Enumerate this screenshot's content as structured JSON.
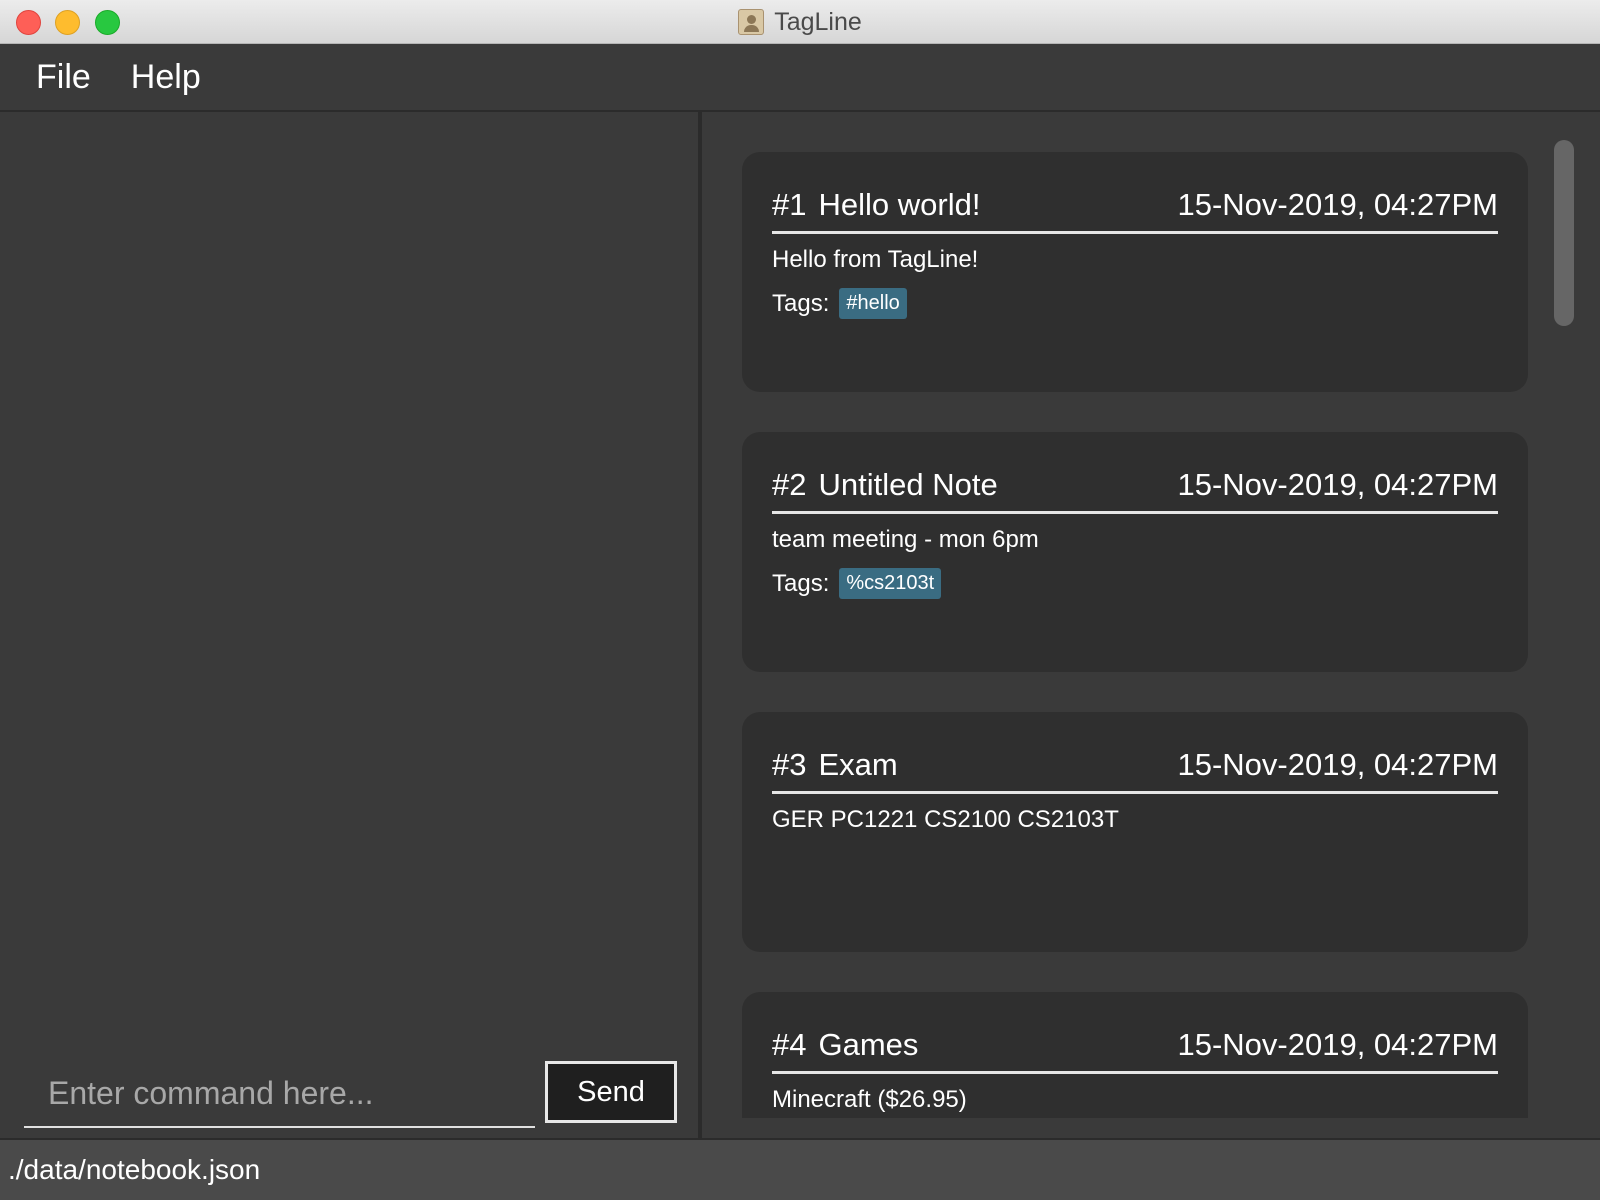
{
  "window": {
    "title": "TagLine"
  },
  "menu": {
    "file": "File",
    "help": "Help"
  },
  "command": {
    "placeholder": "Enter command here...",
    "value": "",
    "send_label": "Send"
  },
  "notes": [
    {
      "id": "#1",
      "title": "Hello world!",
      "date": "15-Nov-2019, 04:27PM",
      "content": "Hello from TagLine!",
      "tags_label": "Tags:",
      "tags": [
        "#hello"
      ]
    },
    {
      "id": "#2",
      "title": "Untitled Note",
      "date": "15-Nov-2019, 04:27PM",
      "content": "team meeting - mon 6pm",
      "tags_label": "Tags:",
      "tags": [
        "%cs2103t"
      ]
    },
    {
      "id": "#3",
      "title": "Exam",
      "date": "15-Nov-2019, 04:27PM",
      "content": "GER PC1221 CS2100 CS2103T"
    },
    {
      "id": "#4",
      "title": "Games",
      "date": "15-Nov-2019, 04:27PM",
      "content": "Minecraft ($26.95)"
    }
  ],
  "status": {
    "path": "./data/notebook.json"
  },
  "colors": {
    "tag_background": "#3a6c82",
    "card_background": "#2f2f2f",
    "app_background": "#3a3a3a"
  },
  "icons": {
    "app": "contacts-app-icon"
  }
}
